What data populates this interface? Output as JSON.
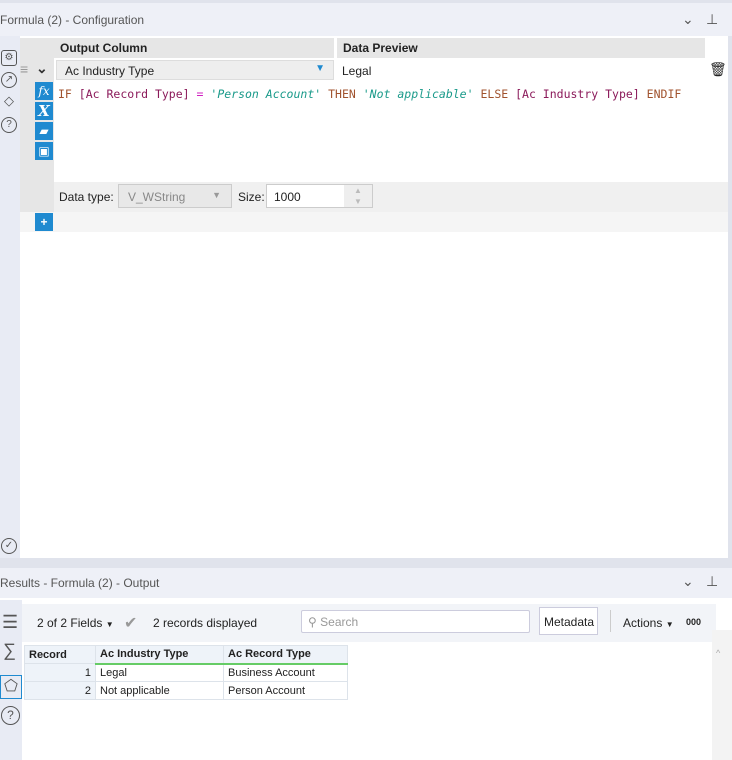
{
  "config": {
    "title": "Formula (2) - Configuration",
    "headers": {
      "output_column": "Output Column",
      "data_preview": "Data Preview"
    },
    "row": {
      "column": "Ac Industry Type",
      "preview": "Legal"
    },
    "formula": {
      "kw_if": "IF",
      "f1": "[Ac Record Type]",
      "op": "=",
      "s1": "'Person Account'",
      "kw_then": "THEN",
      "s2": "'Not applicable'",
      "kw_else": "ELSE",
      "f2": "[Ac Industry Type]",
      "kw_endif": "ENDIF"
    },
    "data_type_label": "Data type:",
    "data_type": "V_WString",
    "size_label": "Size:",
    "size": "1000"
  },
  "results": {
    "title": "Results - Formula (2) - Output",
    "fields": "2 of 2 Fields",
    "records": "2 records displayed",
    "search_placeholder": "Search",
    "metadata": "Metadata",
    "actions": "Actions",
    "more": "000",
    "columns": [
      "Record",
      "Ac Industry Type",
      "Ac Record Type"
    ],
    "rows": [
      [
        "1",
        "Legal",
        "Business Account"
      ],
      [
        "2",
        "Not applicable",
        "Person Account"
      ]
    ]
  },
  "colors": {
    "accent": "#1f8ad0",
    "keyword": "#a0522d",
    "field": "#8b1a5a",
    "string": "#1a9a8a"
  }
}
